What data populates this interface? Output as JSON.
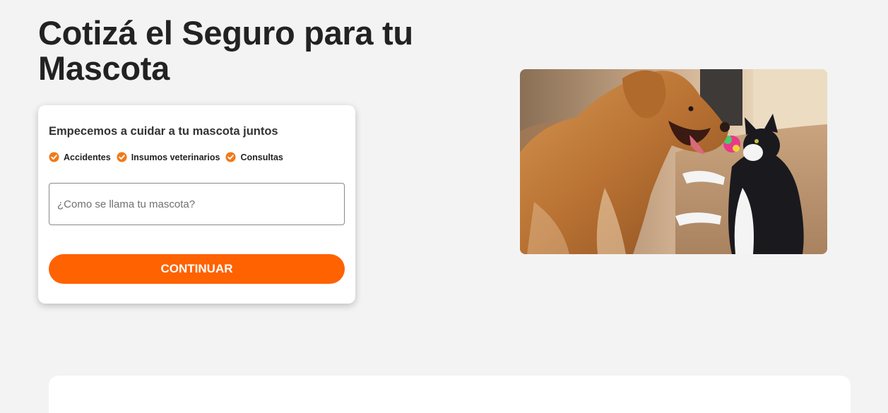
{
  "hero": {
    "title": "Cotizá el Seguro para tu Mascota"
  },
  "form": {
    "heading": "Empecemos a cuidar a tu mascota juntos",
    "coverages": [
      "Accidentes",
      "Insumos veterinarios",
      "Consultas"
    ],
    "pet_name_placeholder": "¿Como se llama tu mascota?",
    "pet_name_value": "",
    "submit_label": "CONTINUAR"
  },
  "colors": {
    "accent": "#ff6200",
    "background": "#f3f3f3",
    "text": "#222222"
  },
  "icons": {
    "coverage_check": "check-circle-icon"
  },
  "image": {
    "subject": "dog-and-cat-playing"
  }
}
